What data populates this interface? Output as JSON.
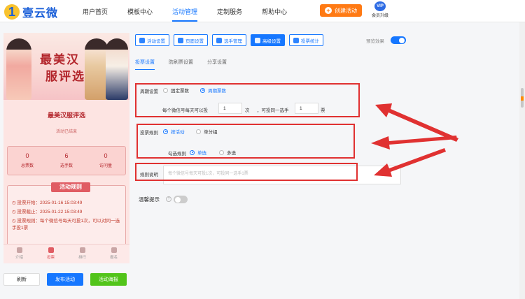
{
  "brand": {
    "name": "壹云微"
  },
  "nav": {
    "items": [
      "用户首页",
      "模板中心",
      "活动管理",
      "定制服务",
      "帮助中心"
    ],
    "active_index": 2,
    "create_label": "创建活动",
    "vip_badge": "VIP",
    "vip_label": "会员升级"
  },
  "preview": {
    "banner_title_1": "最美汉",
    "banner_title_2": "服评选",
    "activity_title": "最美汉服评选",
    "status": "活动已结束",
    "stats": [
      {
        "value": "0",
        "label": "总票数"
      },
      {
        "value": "6",
        "label": "选手数"
      },
      {
        "value": "0",
        "label": "访问量"
      }
    ],
    "rules_title": "活动规则",
    "rules": [
      "投票开始：2025-01-16 15:03:49",
      "投票截止：2025-01-22 15:03:49",
      "投票规则：每个微信号每天可投1次，可以对同一选手投1票"
    ],
    "tabs": [
      "介绍",
      "投票",
      "排行",
      "报名"
    ],
    "active_tab": 1
  },
  "actions": {
    "refresh": "刷新",
    "publish": "发布活动",
    "template": "活动海报"
  },
  "toolbar": {
    "buttons": [
      "活动设置",
      "页面设置",
      "选手管理",
      "高级设置",
      "投票统计"
    ],
    "active_index": 3,
    "preview_label": "预览效果",
    "preview_on": true
  },
  "subtabs": {
    "items": [
      "投票设置",
      "防刷票设置",
      "分享设置"
    ],
    "active_index": 0
  },
  "form": {
    "cycle_label": "周期设置",
    "cycle_options": [
      "固定票数",
      "周期票数"
    ],
    "cycle_selected": 1,
    "daily_prefix": "每个微信号每天可以投",
    "daily_value": "1",
    "daily_unit": "次",
    "per_prefix": "，可投同一选手",
    "per_value": "1",
    "per_unit": "票",
    "vote_rule_label": "投票规则",
    "vote_rule_options": [
      "按活动",
      "单分组"
    ],
    "vote_rule_selected": 0,
    "check_rule_label": "勾选规则",
    "check_rule_options": [
      "单选",
      "多选"
    ],
    "check_rule_selected": 0,
    "rule_desc_label": "规则说明",
    "rule_desc_placeholder": "每个微信号每天可投1次，可投同一选手1票",
    "tip_label": "温馨提示",
    "tip_help": "?",
    "tip_on": false
  },
  "colors": {
    "accent": "#1677ff",
    "annotation": "#e03131",
    "create": "#ff7a14",
    "preview_theme": "#e05c63"
  }
}
